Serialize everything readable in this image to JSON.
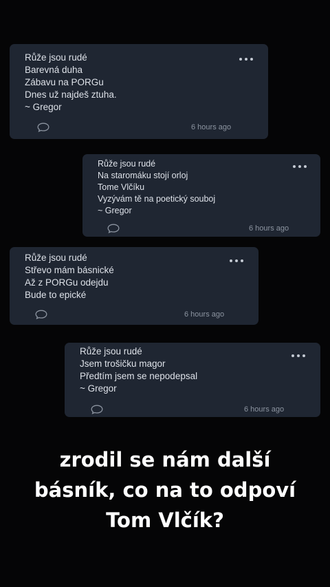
{
  "cards": [
    {
      "lines": [
        "Růže jsou rudé",
        "Barevná duha",
        "Zábavu na PORGu",
        "Dnes už najdeš ztuha.",
        "~ Gregor"
      ],
      "time": "6 hours ago"
    },
    {
      "lines": [
        "Růže jsou rudé",
        "Na staromáku stojí orloj",
        "Tome Vlčíku",
        "Vyzývám tě na poetický souboj",
        "~ Gregor"
      ],
      "time": "6 hours ago"
    },
    {
      "lines": [
        "Růže jsou rudé",
        "Střevo mám básnické",
        "Až z PORGu odejdu",
        "Bude to epické"
      ],
      "time": "6 hours ago"
    },
    {
      "lines": [
        "Růže jsou rudé",
        "Jsem trošičku magor",
        "Předtím jsem se nepodepsal",
        "~ Gregor"
      ],
      "time": "6 hours ago"
    }
  ],
  "caption": [
    "zrodil se nám další",
    "básník, co na to odpoví",
    "Tom Vlčík?"
  ],
  "icons": {
    "more": "more-options-icon",
    "comment": "comment-bubble-icon"
  },
  "colors": {
    "background": "#050506",
    "card": "#1f2632",
    "text": "#dde1e8",
    "muted": "#8c94a0",
    "caption": "#ffffff"
  }
}
